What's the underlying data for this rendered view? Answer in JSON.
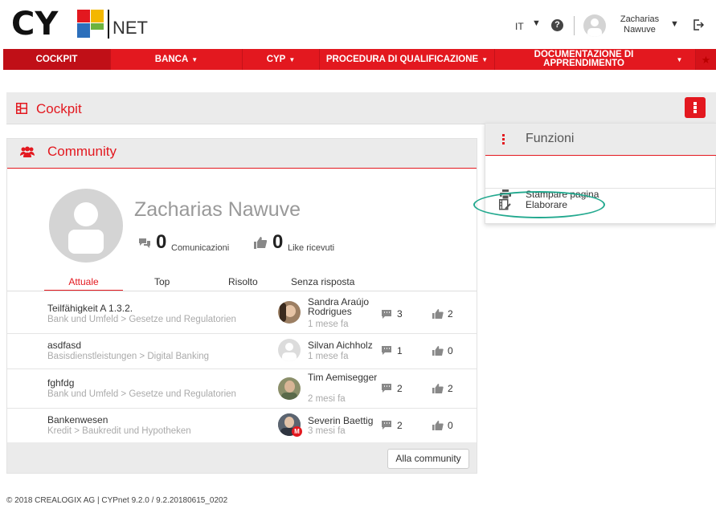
{
  "brand": {
    "logo": "CYP",
    "net": "NET",
    "accent": "#e3181f",
    "highlight": "#23a98f"
  },
  "header": {
    "language": "IT",
    "user_name": "Zacharias Nawuve"
  },
  "nav": {
    "cockpit": "COCKPIT",
    "banca": "BANCA",
    "cyp": "CYP",
    "procedura": "PROCEDURA DI QUALIFICAZIONE",
    "documentazione": "DOCUMENTAZIONE DI APPRENDIMENTO"
  },
  "page": {
    "title": "Cockpit"
  },
  "community": {
    "title": "Community",
    "profile_name": "Zacharias Nawuve",
    "messages_count": "0",
    "messages_label": "Comunicazioni",
    "likes_count": "0",
    "likes_label": "Like ricevuti",
    "tabs": [
      "Attuale",
      "Top",
      "Risolto",
      "Senza risposta"
    ],
    "rows": [
      {
        "title": "Teilfähigkeit A 1.3.2.",
        "path": "Bank und Umfeld > Gesetze und Regulatorien",
        "author": "Sandra Araújo Rodrigues",
        "time": "1 mese fa",
        "comments": "3",
        "likes": "2"
      },
      {
        "title": "asdfasd",
        "path": "Basisdienstleistungen > Digital Banking",
        "author": "Silvan Aichholz",
        "time": "1 mese fa",
        "comments": "1",
        "likes": "0"
      },
      {
        "title": "fghfdg",
        "path": "Bank und Umfeld > Gesetze und Regulatorien",
        "author": "Tim Aemisegger",
        "time": "2 mesi fa",
        "comments": "2",
        "likes": "2"
      },
      {
        "title": "Bankenwesen",
        "path": "Kredit > Baukredit und Hypotheken",
        "author": "Severin Baettig",
        "time": "3 mesi fa",
        "comments": "2",
        "likes": "0"
      }
    ],
    "button": "Alla community"
  },
  "funzioni": {
    "title": "Funzioni",
    "items": [
      "Stampare pagina",
      "Elaborare"
    ]
  },
  "footer": {
    "text": "© 2018 CREALOGIX AG  |  CYPnet 9.2.0 / 9.2.20180615_0202"
  }
}
